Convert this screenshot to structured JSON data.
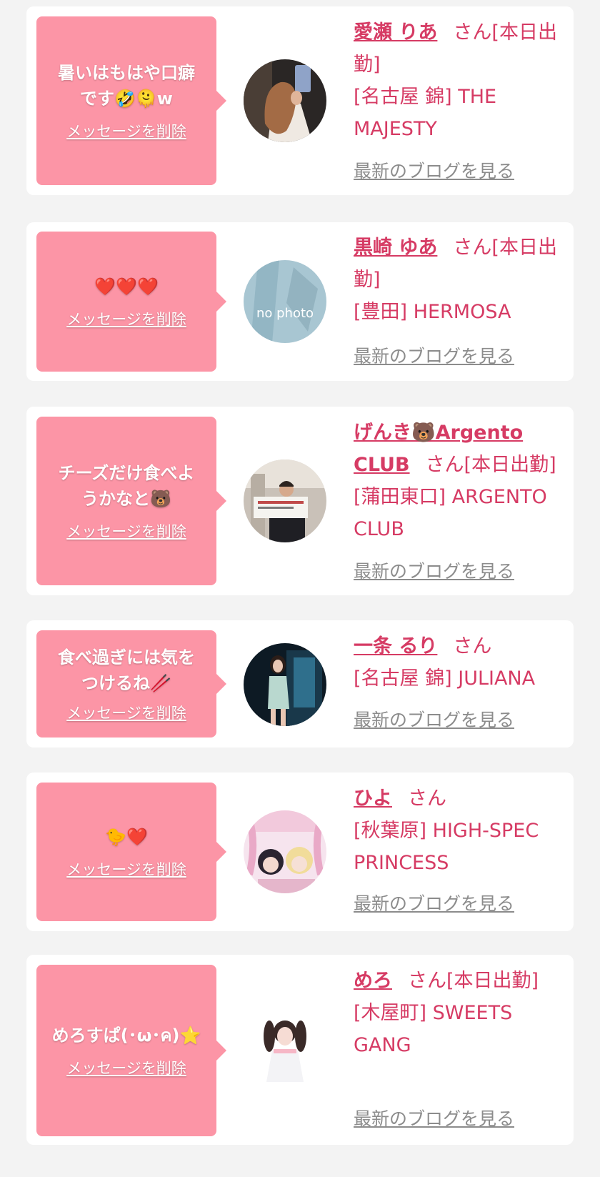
{
  "colors": {
    "page_bg": "#f3f3f3",
    "card_bg": "#ffffff",
    "bubble_bg": "#fc95a6",
    "name_text": "#d63b64",
    "blog_link": "#8c8c8c"
  },
  "cards": [
    {
      "message": "暑いはもはや口癖\nです🤣🫠w",
      "delete_label": "メッセージを削除",
      "avatar_icon": "photo-woman-mirror-selfie",
      "name": "愛瀬 りあ",
      "suffix": "さん[本日出勤]",
      "shop": "[名古屋 錦] THE MAJESTY",
      "blog_label": "最新のブログを見る"
    },
    {
      "message": "❤️❤️❤️",
      "delete_label": "メッセージを削除",
      "avatar_icon": "no-photo-placeholder",
      "avatar_text": "no photo",
      "name": "黒崎 ゆあ",
      "suffix": "さん[本日出勤]",
      "shop": "[豊田] HERMOSA",
      "blog_label": "最新のブログを見る"
    },
    {
      "message": "チーズだけ食べよ\nうかなと🐻",
      "delete_label": "メッセージを削除",
      "avatar_icon": "photo-man-holding-sign",
      "name": "げんき🐻Argento CLUB",
      "suffix": "さん[本日出勤]",
      "shop": "[蒲田東口] ARGENTO CLUB",
      "blog_label": "最新のブログを見る"
    },
    {
      "message": "食べ過ぎには気を\nつけるね🥢",
      "delete_label": "メッセージを削除",
      "avatar_icon": "photo-woman-dress",
      "name": "一条 るり",
      "suffix": "さん",
      "shop": "[名古屋 錦] JULIANA",
      "blog_label": "最新のブログを見る"
    },
    {
      "message": "🐤❤️",
      "delete_label": "メッセージを削除",
      "avatar_icon": "photo-two-girls-pink",
      "name": "ひよ",
      "suffix": "さん",
      "shop": "[秋葉原] HIGH-SPEC PRINCESS",
      "blog_label": "最新のブログを見る"
    },
    {
      "message": "めろすぱ(･ω･ค)⭐",
      "delete_label": "メッセージを削除",
      "avatar_icon": "photo-girl-twintails",
      "name": "めろ",
      "suffix": "さん[本日出勤]",
      "shop": "[木屋町] SWEETS GANG",
      "blog_label": "最新のブログを見る"
    }
  ]
}
